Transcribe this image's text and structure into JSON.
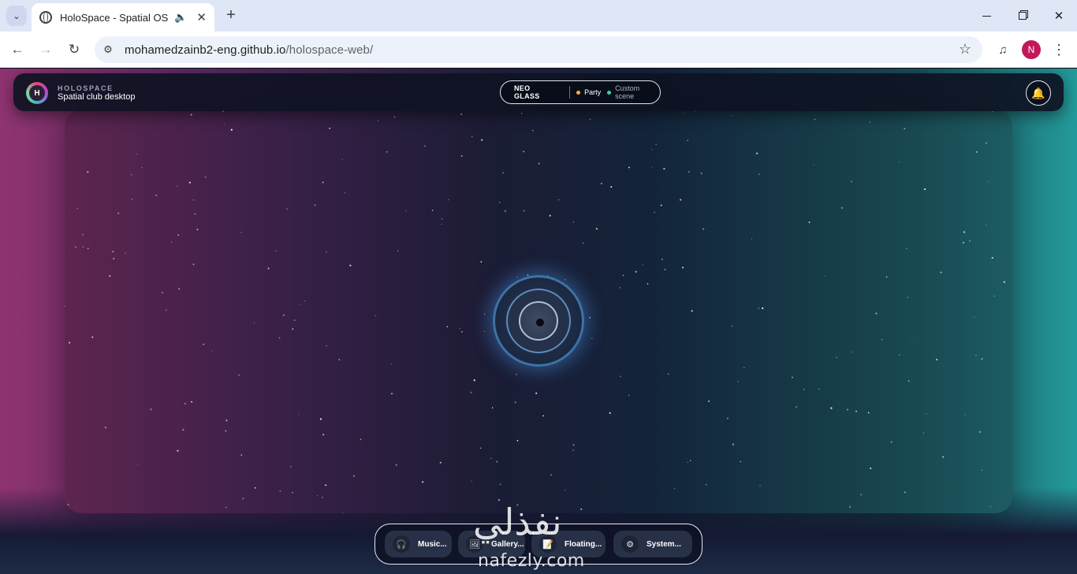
{
  "browser": {
    "tab_title": "HoloSpace - Spatial OS",
    "url_host": "mohamedzainb2-eng.github.io",
    "url_path": "/holospace-web/",
    "profile_initial": "N"
  },
  "header": {
    "avatar_letter": "H",
    "brand_name": "HOLOSPACE",
    "brand_subtitle": "Spatial club desktop",
    "theme_name": "NEO GLASS",
    "mode_label": "Party",
    "scene_label": "Custom scene",
    "notification_icon": "bell-icon"
  },
  "dock": {
    "items": [
      {
        "label": "Music...",
        "icon": "headphones-icon"
      },
      {
        "label": "Gallery...",
        "icon": "image-icon"
      },
      {
        "label": "Floating...",
        "icon": "note-icon"
      },
      {
        "label": "System...",
        "icon": "gear-icon"
      }
    ]
  },
  "watermark": {
    "arabic": "نفذلي",
    "latin": "nafezly.com"
  },
  "colors": {
    "accent_yellow": "#f6b426",
    "accent_teal": "#3ad0b6",
    "orb_glow": "#3d73a6",
    "profile": "#c2185b"
  }
}
